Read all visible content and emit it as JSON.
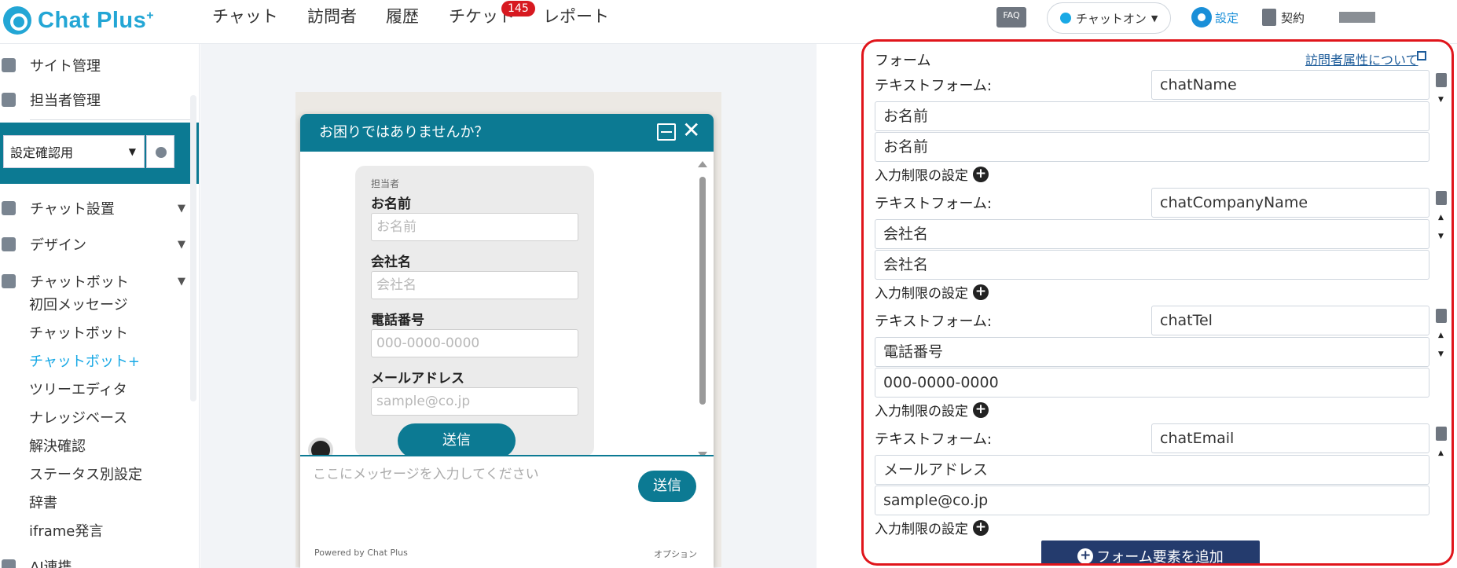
{
  "header": {
    "brand": "Chat Plus",
    "brand_sup": "+",
    "nav": [
      "チャット",
      "訪問者",
      "履歴",
      "チケット",
      "レポート"
    ],
    "ticket_badge": "145",
    "faq": "FAQ",
    "chat_status": "チャットオン",
    "settings": "設定",
    "contract": "契約"
  },
  "sidebar": {
    "site_admin": "サイト管理",
    "staff_admin": "担当者管理",
    "site_select": "設定確認用",
    "sections": [
      "チャット設置",
      "デザイン",
      "チャットボット"
    ],
    "sub_items": [
      "初回メッセージ",
      "チャットボット",
      "チャットボット+",
      "ツリーエディタ",
      "ナレッジベース",
      "解決確認",
      "ステータス別設定",
      "辞書",
      "iframe発言"
    ],
    "active_sub": "チャットボット+",
    "cut_item": "AI連携"
  },
  "widget": {
    "title": "お困りではありませんか？",
    "staff_label": "担当者",
    "fields": [
      {
        "label": "お名前",
        "placeholder": "お名前"
      },
      {
        "label": "会社名",
        "placeholder": "会社名"
      },
      {
        "label": "電話番号",
        "placeholder": "000-0000-0000"
      },
      {
        "label": "メールアドレス",
        "placeholder": "sample@co.jp"
      }
    ],
    "submit": "送信",
    "message_placeholder": "ここにメッセージを入力してください",
    "send": "送信",
    "powered": "Powered by Chat Plus",
    "option": "オプション"
  },
  "panel": {
    "title": "フォーム",
    "link": "訪問者属性について",
    "field_type_label": "テキストフォーム:",
    "limit_label": "入力制限の設定",
    "add_button": "フォーム要素を追加",
    "fields": [
      {
        "key": "chatName",
        "label": "お名前",
        "placeholder": "お名前"
      },
      {
        "key": "chatCompanyName",
        "label": "会社名",
        "placeholder": "会社名"
      },
      {
        "key": "chatTel",
        "label": "電話番号",
        "placeholder": "000-0000-0000"
      },
      {
        "key": "chatEmail",
        "label": "メールアドレス",
        "placeholder": "sample@co.jp"
      }
    ]
  },
  "colors": {
    "accent": "#19a9e5",
    "widget_teal": "#0c7a93",
    "highlight_border": "#e0151b",
    "add_button": "#243b6d"
  }
}
